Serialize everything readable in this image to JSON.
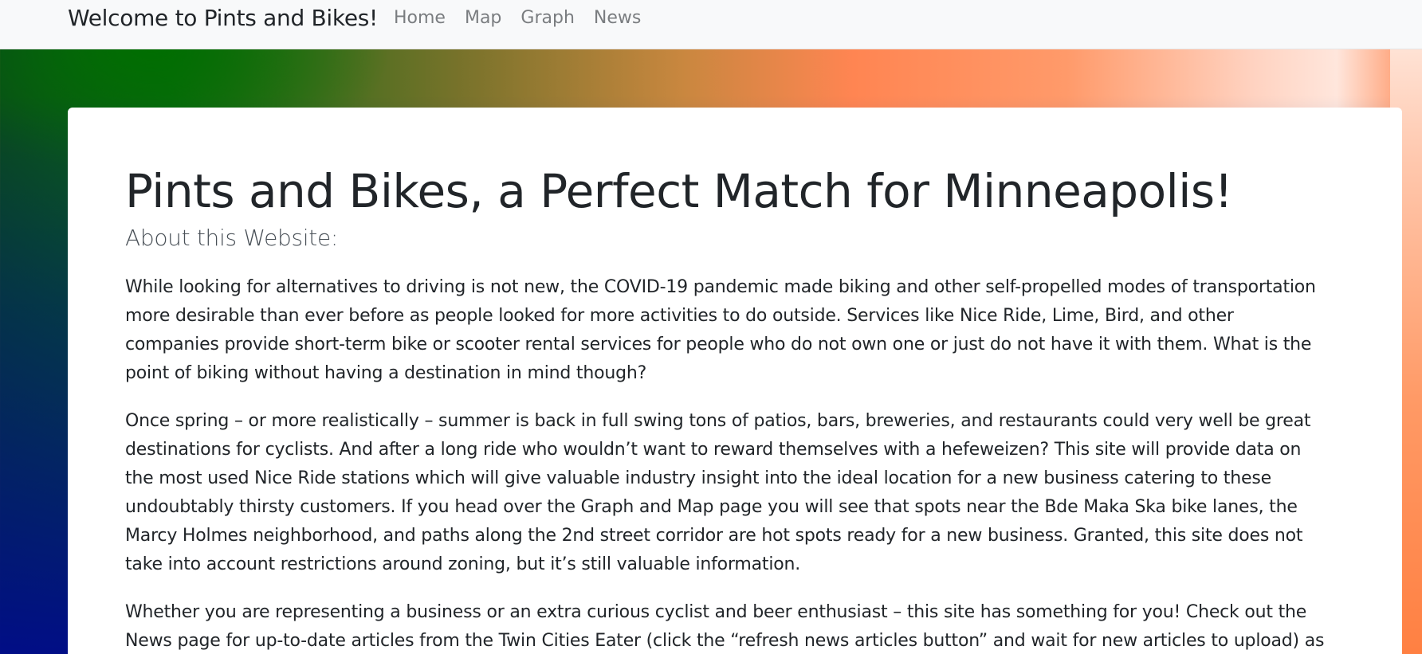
{
  "navbar": {
    "brand": "Welcome to Pints and Bikes!",
    "links": [
      "Home",
      "Map",
      "Graph",
      "News"
    ]
  },
  "main": {
    "title": "Pints and Bikes, a Perfect Match for Minneapolis!",
    "subtitle": "About this Website:",
    "paragraphs": [
      "While looking for alternatives to driving is not new, the COVID-19 pandemic made biking and other self-propelled modes of transportation more desirable than ever before as people looked for more activities to do outside. Services like Nice Ride, Lime, Bird, and other companies provide short-term bike or scooter rental services for people who do not own one or just do not have it with them. What is the point of biking without having a destination in mind though?",
      "Once spring – or more realistically – summer is back in full swing tons of patios, bars, breweries, and restaurants could very well be great destinations for cyclists. And after a long ride who wouldn’t want to reward themselves with a hefeweizen? This site will provide data on the most used Nice Ride stations which will give valuable industry insight into the ideal location for a new business catering to these undoubtably thirsty customers. If you head over the Graph and Map page you will see that spots near the Bde Maka Ska bike lanes, the Marcy Holmes neighborhood, and paths along the 2nd street corridor are hot spots ready for a new business. Granted, this site does not take into account restrictions around zoning, but it’s still valuable information.",
      "Whether you are representing a business or an extra curious cyclist and beer enthusiast – this site has something for you! Check out the News page for up-to-date articles from the Twin Cities Eater (click the “refresh news articles button” and wait for new articles to upload) as well as"
    ]
  },
  "colors": {
    "navbar_bg": "#f8f9fa",
    "text": "#212529",
    "nav_link": "#7a7d80",
    "card_bg": "#ffffff"
  }
}
